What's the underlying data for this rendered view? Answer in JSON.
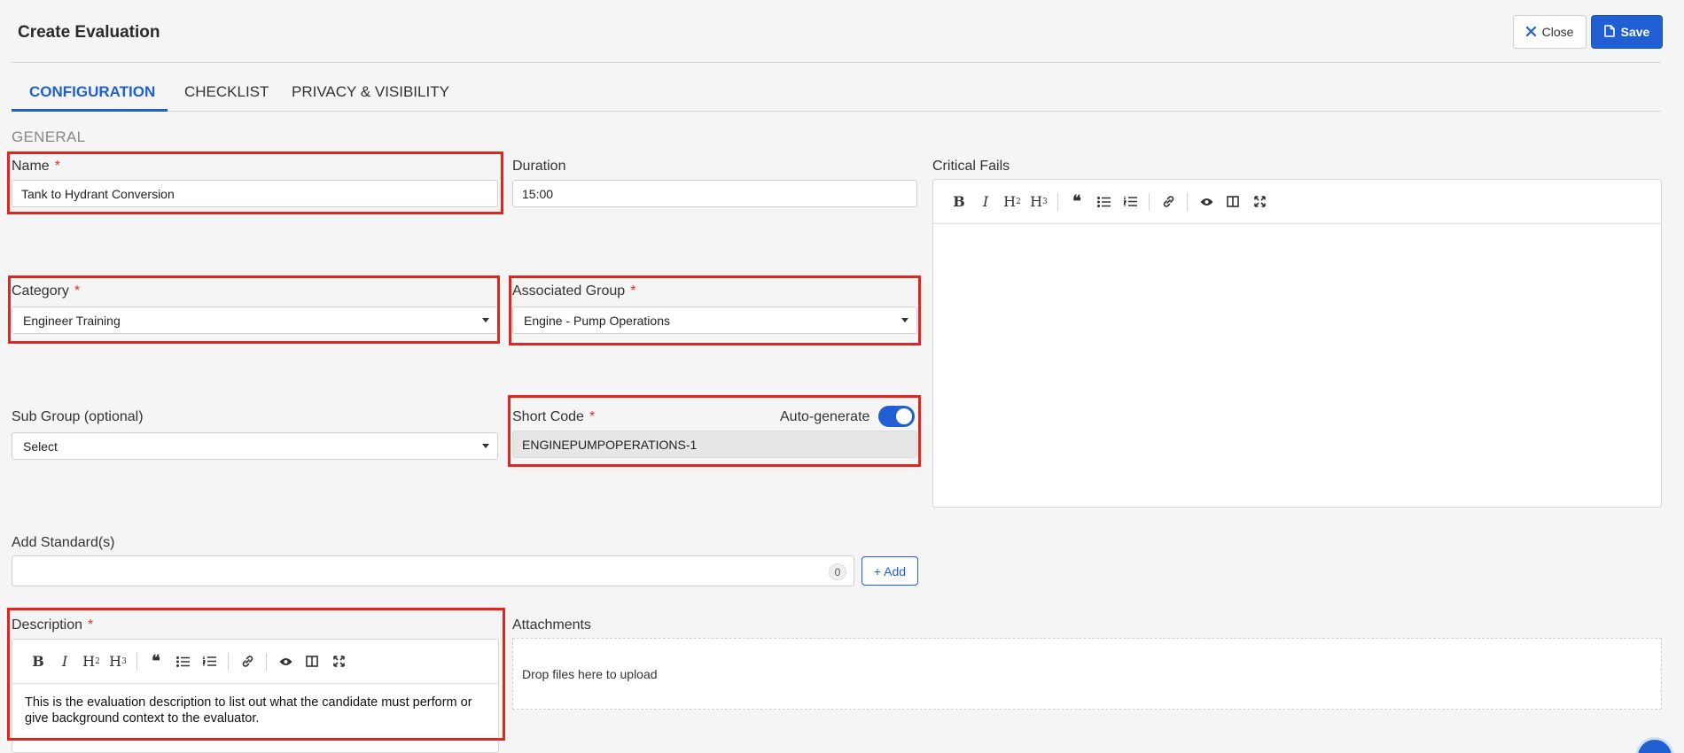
{
  "header": {
    "title": "Create Evaluation",
    "close_label": "Close",
    "save_label": "Save"
  },
  "tabs": [
    {
      "label": "CONFIGURATION",
      "active": true
    },
    {
      "label": "CHECKLIST",
      "active": false
    },
    {
      "label": "PRIVACY & VISIBILITY",
      "active": false
    }
  ],
  "general": {
    "section_title": "GENERAL",
    "name": {
      "label": "Name",
      "required": "*",
      "value": "Tank to Hydrant Conversion"
    },
    "duration": {
      "label": "Duration",
      "value": "15:00"
    },
    "critical_fails": {
      "label": "Critical Fails"
    },
    "category": {
      "label": "Category",
      "required": "*",
      "value": "Engineer Training"
    },
    "associated_group": {
      "label": "Associated Group",
      "required": "*",
      "value": "Engine - Pump Operations"
    },
    "sub_group": {
      "label": "Sub Group (optional)",
      "value": "Select"
    },
    "short_code": {
      "label": "Short Code",
      "required": "*",
      "auto_generate_label": "Auto-generate",
      "auto_generate_on": true,
      "value": "ENGINEPUMPOPERATIONS-1"
    },
    "standards": {
      "label": "Add Standard(s)",
      "count": "0",
      "add_label": "+ Add"
    },
    "description": {
      "label": "Description",
      "required": "*",
      "value": "This is the evaluation description to list out what the candidate must perform or give background context to the evaluator."
    },
    "attachments": {
      "label": "Attachments",
      "dropzone_text": "Drop files here to upload"
    }
  },
  "editor_toolbar": [
    "bold-icon",
    "italic-icon",
    "heading-2-icon",
    "heading-3-icon",
    "quote-icon",
    "unordered-list-icon",
    "ordered-list-icon",
    "link-icon",
    "preview-icon",
    "side-by-side-icon",
    "fullscreen-icon"
  ],
  "colors": {
    "accent": "#1f5fd1",
    "highlight": "#e0261f",
    "required": "#e03030",
    "background": "#f5f5f5"
  }
}
